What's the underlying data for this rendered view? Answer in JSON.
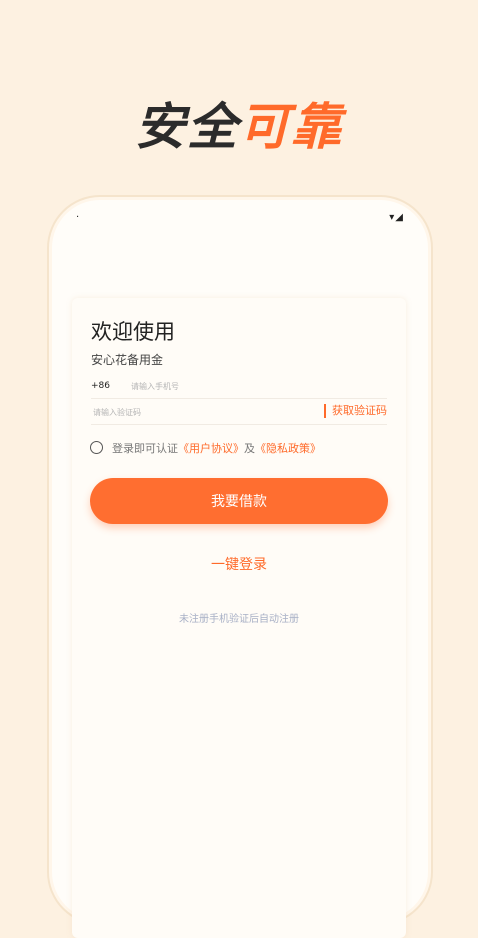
{
  "promo": {
    "dark": "安全",
    "accent": "可靠"
  },
  "status": {
    "left": "·",
    "right": "▾◢"
  },
  "login": {
    "title": "欢迎使用",
    "subtitle": "安心花备用金",
    "phone_prefix": "+86",
    "phone_placeholder": "请输入手机号",
    "code_placeholder": "请输入验证码",
    "get_code": "获取验证码",
    "agree_prefix": "登录即可认证",
    "user_agreement": "《用户协议》",
    "agree_and": "及",
    "privacy_policy": "《隐私政策》",
    "primary_button": "我要借款",
    "one_key_login": "一键登录",
    "note": "未注册手机验证后自动注册"
  },
  "colors": {
    "accent": "#ff6a2a",
    "background": "#fdf1e1",
    "text_dark": "#2b2b2b"
  }
}
